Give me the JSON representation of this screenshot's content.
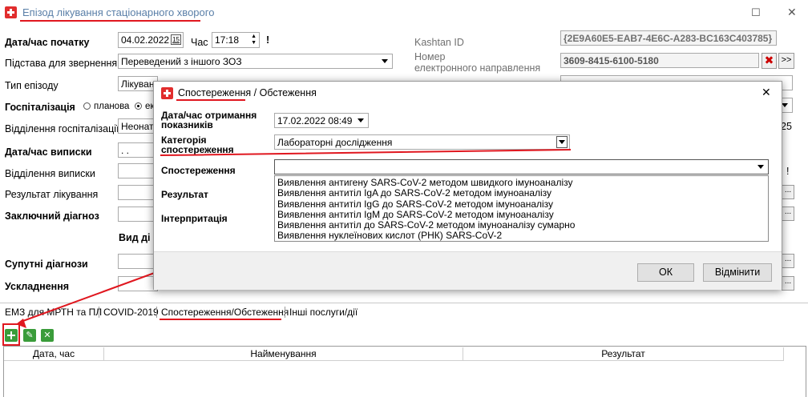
{
  "window": {
    "title": "Епізод лікування стаціонарного хворого",
    "close_glyph": "✕",
    "maximize_glyph": "☐"
  },
  "form": {
    "start_label": "Дата/час початку",
    "start_date": "04.02.2022",
    "calendar_day": "15",
    "time_label": "Час",
    "start_time": "17:18",
    "required_mark": "!",
    "reason_label": "Підстава для звернення",
    "reason_value": "Переведений з іншого ЗОЗ",
    "type_label": "Тип епізоду",
    "type_value": "Лікуван",
    "hosp_label": "Госпіталізація",
    "hosp_option_planned": "планова",
    "hosp_option_emergency": "ек",
    "dept_label": "Відділення госпіталізації",
    "dept_value": "Неонато",
    "dept_right_value": "25",
    "discharge_label": "Дата/час виписки",
    "discharge_value": ". .",
    "discharge_dept_label": "Відділення виписки",
    "result_label": "Результат лікування",
    "final_diag_label": "Заключний діагноз",
    "diag_type_label": "Вид ді",
    "concomitant_label": "Супутні діагнози",
    "complications_label": "Ускладнення",
    "kashtan_label": "Kashtan ID",
    "kashtan_value": "{2E9A60E5-EAB7-4E6C-A283-BC163C403785}",
    "referral_label_1": "Номер",
    "referral_label_2": "електронного направлення",
    "referral_value": "3609-8415-6100-5180",
    "clear_glyph": "✖",
    "more_glyph": ">>",
    "ellipsis": "...",
    "exclam_right": "!"
  },
  "dialog": {
    "title": "Спостереження / Обстеження",
    "close_glyph": "✕",
    "received_label_1": "Дата/час отримання",
    "received_label_2": "показників",
    "received_value": "17.02.2022 08:49",
    "category_label_1": "Категорія",
    "category_label_2": "спостереження",
    "category_value": "Лабораторні дослідження",
    "observation_label": "Спостереження",
    "observation_value": "",
    "result_label": "Результат",
    "interpretation_label": "Інтерпритація",
    "options": [
      "Виявлення антигену SARS-CoV-2 методом швидкого імуноаналізу",
      "Виявлення антитіл IgA до SARS-CoV-2 методом імуноаналізу",
      "Виявлення антитіл IgG до SARS-CoV-2 методом імуноаналізу",
      "Виявлення антитіл IgM до SARS-CoV-2 методом імуноаналізу",
      "Виявлення антитіл до SARS-CoV-2 методом імуноаналізу сумарно",
      "Виявлення нуклеїнових кислот (РНК) SARS-CoV-2"
    ],
    "ok_label": "ОК",
    "cancel_label": "Відмінити"
  },
  "tabs": [
    "ЕМЗ для МРТН та ПЛ",
    "COVID-2019",
    "Спостереження/Обстеження",
    "Інші послуги/дії"
  ],
  "grid": {
    "columns": [
      "Дата, час",
      "Найменування",
      "Результат"
    ]
  },
  "colors": {
    "accent_red": "#e0171f",
    "icon_red": "#e12d2d",
    "tool_green": "#3a9c3a"
  }
}
